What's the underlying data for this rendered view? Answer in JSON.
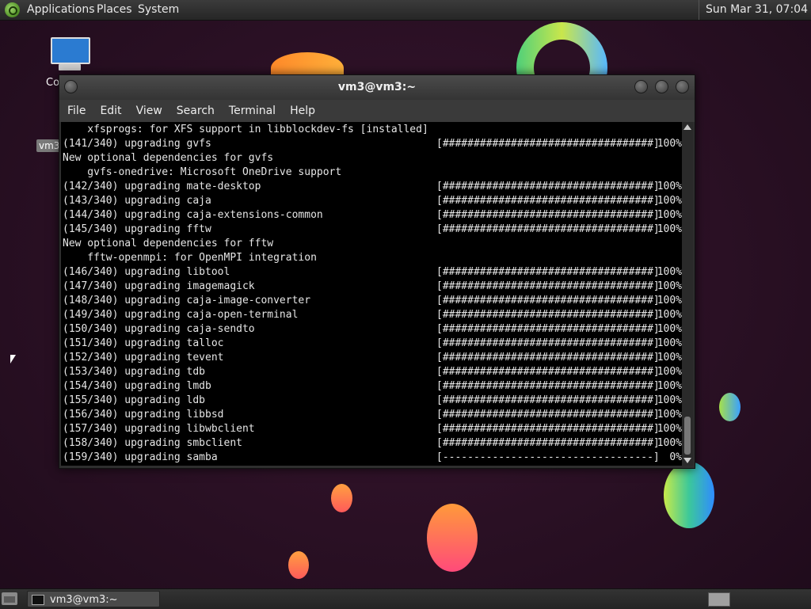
{
  "top_panel": {
    "menu": [
      "Applications",
      "Places",
      "System"
    ],
    "clock": "Sun Mar 31, 07:04"
  },
  "desktop": {
    "computer_label": "Co",
    "home_label": "vm3"
  },
  "window": {
    "title": "vm3@vm3:~",
    "menu": [
      "File",
      "Edit",
      "View",
      "Search",
      "Terminal",
      "Help"
    ]
  },
  "terminal_lines": [
    {
      "left": "    xfsprogs: for XFS support in libblockdev-fs [installed]",
      "bar": "",
      "pct": ""
    },
    {
      "left": "(141/340) upgrading gvfs",
      "bar": "[##################################]",
      "pct": "100%"
    },
    {
      "left": "New optional dependencies for gvfs",
      "bar": "",
      "pct": ""
    },
    {
      "left": "    gvfs-onedrive: Microsoft OneDrive support",
      "bar": "",
      "pct": ""
    },
    {
      "left": "(142/340) upgrading mate-desktop",
      "bar": "[##################################]",
      "pct": "100%"
    },
    {
      "left": "(143/340) upgrading caja",
      "bar": "[##################################]",
      "pct": "100%"
    },
    {
      "left": "(144/340) upgrading caja-extensions-common",
      "bar": "[##################################]",
      "pct": "100%"
    },
    {
      "left": "(145/340) upgrading fftw",
      "bar": "[##################################]",
      "pct": "100%"
    },
    {
      "left": "New optional dependencies for fftw",
      "bar": "",
      "pct": ""
    },
    {
      "left": "    fftw-openmpi: for OpenMPI integration",
      "bar": "",
      "pct": ""
    },
    {
      "left": "(146/340) upgrading libtool",
      "bar": "[##################################]",
      "pct": "100%"
    },
    {
      "left": "(147/340) upgrading imagemagick",
      "bar": "[##################################]",
      "pct": "100%"
    },
    {
      "left": "(148/340) upgrading caja-image-converter",
      "bar": "[##################################]",
      "pct": "100%"
    },
    {
      "left": "(149/340) upgrading caja-open-terminal",
      "bar": "[##################################]",
      "pct": "100%"
    },
    {
      "left": "(150/340) upgrading caja-sendto",
      "bar": "[##################################]",
      "pct": "100%"
    },
    {
      "left": "(151/340) upgrading talloc",
      "bar": "[##################################]",
      "pct": "100%"
    },
    {
      "left": "(152/340) upgrading tevent",
      "bar": "[##################################]",
      "pct": "100%"
    },
    {
      "left": "(153/340) upgrading tdb",
      "bar": "[##################################]",
      "pct": "100%"
    },
    {
      "left": "(154/340) upgrading lmdb",
      "bar": "[##################################]",
      "pct": "100%"
    },
    {
      "left": "(155/340) upgrading ldb",
      "bar": "[##################################]",
      "pct": "100%"
    },
    {
      "left": "(156/340) upgrading libbsd",
      "bar": "[##################################]",
      "pct": "100%"
    },
    {
      "left": "(157/340) upgrading libwbclient",
      "bar": "[##################################]",
      "pct": "100%"
    },
    {
      "left": "(158/340) upgrading smbclient",
      "bar": "[##################################]",
      "pct": "100%"
    },
    {
      "left": "(159/340) upgrading samba",
      "bar": "[----------------------------------]",
      "pct": "0%"
    }
  ],
  "taskbar": {
    "window_label": "vm3@vm3:~"
  },
  "colors": {
    "terminal_bg": "#000000",
    "terminal_fg": "#e6e6e6",
    "desktop_bg": "#2a1024"
  },
  "icons": [
    "apps-menu-icon",
    "computer-icon",
    "terminal-icon",
    "show-desktop-icon",
    "workspace-switcher-icon"
  ]
}
